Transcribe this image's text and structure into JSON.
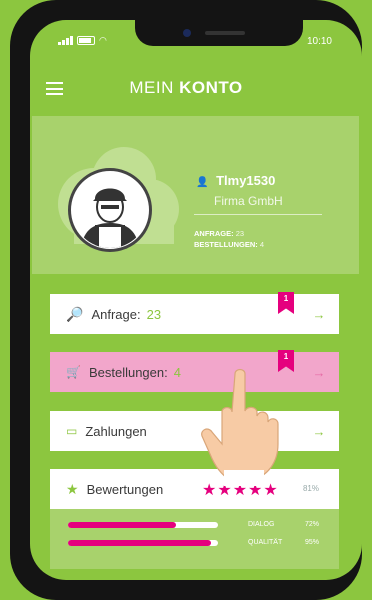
{
  "status_bar": {
    "time": "10:10"
  },
  "header": {
    "title_light": "MEIN ",
    "title_bold": "KONTO"
  },
  "profile": {
    "username": "Tlmy1530",
    "company": "Firma GmbH",
    "requests_label": "ANFRAGE:",
    "requests_value": "23",
    "orders_label": "BESTELLUNGEN:",
    "orders_value": "4"
  },
  "cards": [
    {
      "label": "Anfrage:",
      "count": "23",
      "badge": "1",
      "icon": "magnifier-icon"
    },
    {
      "label": "Bestellungen:",
      "count": "4",
      "badge": "1",
      "icon": "cart-icon"
    },
    {
      "label": "Zahlungen",
      "icon": "wallet-icon"
    },
    {
      "label": "Bewertungen",
      "stars": "★★★★★",
      "percent": "81%",
      "icon": "star-icon"
    }
  ],
  "ratings": [
    {
      "label": "DIALOG",
      "percent": "72%",
      "value": 0.72
    },
    {
      "label": "QUALITÄT",
      "percent": "95%",
      "value": 0.95
    }
  ],
  "colors": {
    "accent": "#8cc63f",
    "pink": "#e5007e",
    "panel": "#a8d26c"
  }
}
